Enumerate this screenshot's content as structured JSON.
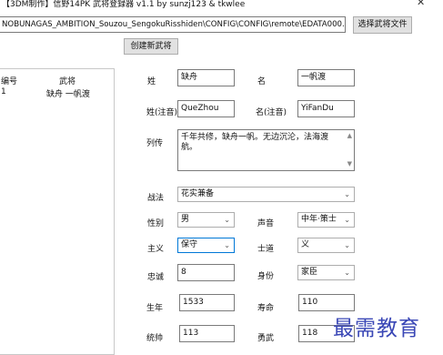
{
  "title": "【3DM制作】信野14PK 武将登録器 v1.1 by sunzj123 & tkwlee",
  "path_value": "NOBUNAGAS_AMBITION_Souzou_SengokuRisshiden\\CONFIG\\CONFIG\\remote\\EDATA000.SRQ",
  "buttons": {
    "select_file": "选择武将文件",
    "create": "创建新武将"
  },
  "list": {
    "headers": {
      "id": "编号",
      "name": "武将"
    },
    "rows": [
      {
        "id": "1",
        "name": "缺舟 一帆渡"
      }
    ]
  },
  "form": {
    "surname_label": "姓",
    "surname_value": "缺舟",
    "given_label": "名",
    "given_value": "一帆渡",
    "surname_reading_label": "姓(注音)",
    "surname_reading_value": "QueZhou",
    "given_reading_label": "名(注音)",
    "given_reading_value": "YiFanDu",
    "bio_label": "列传",
    "bio_value": "千年共修，缺舟一帆。无边沉沦，法海渡航。",
    "tactic_label": "战法",
    "tactic_value": "花实兼备",
    "gender_label": "性别",
    "gender_value": "男",
    "voice_label": "声音",
    "voice_value": "中年·策士",
    "ideology_label": "主义",
    "ideology_value": "保守",
    "path_label": "士道",
    "path_value": "义",
    "loyalty_label": "忠诚",
    "loyalty_value": "8",
    "status_label": "身份",
    "status_value": "家臣",
    "birth_label": "生年",
    "birth_value": "1533",
    "lifespan_label": "寿命",
    "lifespan_value": "110",
    "command_label": "统帅",
    "command_value": "113",
    "valor_label": "勇武",
    "valor_value": "118"
  },
  "watermark": "最需教育",
  "icons": {
    "close": "close-icon",
    "dropdown": "chevron-down-icon"
  }
}
